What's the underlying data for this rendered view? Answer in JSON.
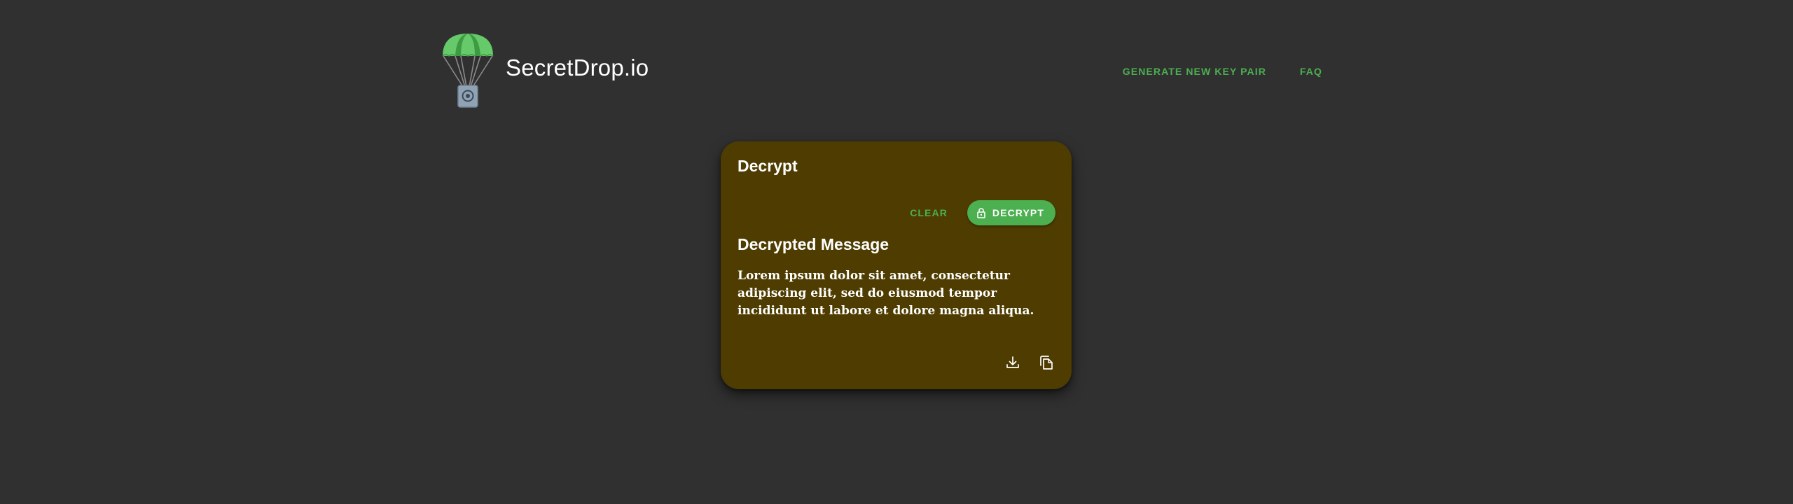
{
  "header": {
    "brand": "SecretDrop.io",
    "logo_icon": "parachute-icon",
    "nav": [
      {
        "label": "GENERATE NEW KEY PAIR"
      },
      {
        "label": "FAQ"
      }
    ]
  },
  "card": {
    "title": "Decrypt",
    "clear_label": "CLEAR",
    "decrypt_label": "DECRYPT",
    "decrypt_icon": "lock-icon",
    "result_title": "Decrypted Message",
    "message": "Lorem ipsum dolor sit amet, consectetur adipiscing elit, sed do eiusmod tempor incididunt ut labore et dolore magna aliqua.",
    "download_icon": "download-icon",
    "copy_icon": "copy-icon"
  },
  "colors": {
    "background": "#303030",
    "card": "#4e3c00",
    "accent": "#4caf50",
    "text": "#ffffff"
  }
}
